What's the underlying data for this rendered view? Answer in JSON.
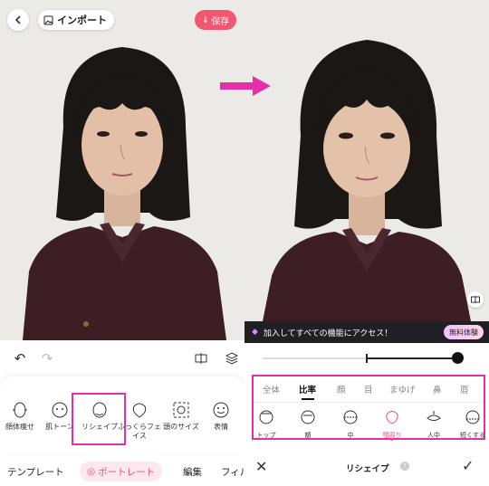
{
  "left": {
    "header": {
      "import_label": "インポート",
      "save_label": "保存"
    },
    "tools": [
      {
        "label": "顔体痩せ",
        "icon": "face-slim-icon"
      },
      {
        "label": "肌トーン",
        "icon": "skin-tone-icon"
      },
      {
        "label": "リシェイプ",
        "icon": "reshape-icon"
      },
      {
        "label": "ふっくらフェイス",
        "icon": "plump-face-icon"
      },
      {
        "label": "頭のサイズ",
        "icon": "head-size-icon"
      },
      {
        "label": "表情",
        "icon": "expression-icon"
      }
    ],
    "nav": {
      "templates": "テンプレート",
      "portrait": "ポートレート",
      "edit": "編集",
      "filter": "フィル"
    }
  },
  "right": {
    "promo": {
      "text": "加入してすべての機能にアクセス！",
      "button": "無料体験"
    },
    "slider": {
      "value": 1.0
    },
    "categories": [
      "全体",
      "比率",
      "顔",
      "目",
      "まゆげ",
      "鼻",
      "唇"
    ],
    "active_category": "比率",
    "sub_tools": [
      {
        "label": "トップ",
        "icon": "top-icon"
      },
      {
        "label": "額",
        "icon": "forehead-icon"
      },
      {
        "label": "中",
        "icon": "middle-icon"
      },
      {
        "label": "顎周り",
        "icon": "jawline-icon"
      },
      {
        "label": "人中",
        "icon": "philtrum-icon"
      },
      {
        "label": "短くする",
        "icon": "shorten-icon"
      }
    ],
    "active_sub_tool": "顎周り",
    "bottom": {
      "title": "リシェイプ"
    }
  },
  "colors": {
    "accent": "#e52fa8",
    "save": "#f2576f",
    "portrait_active": "#e8507a"
  }
}
